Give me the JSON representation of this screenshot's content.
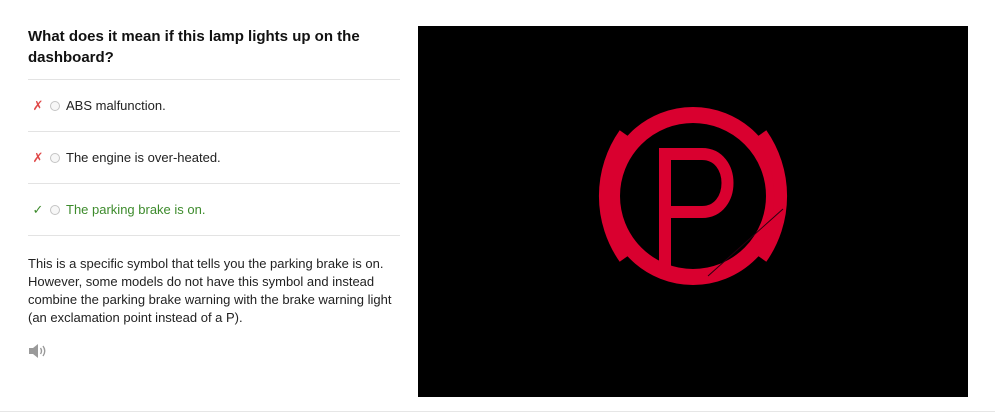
{
  "question": "What does it mean if this lamp lights up on the dashboard?",
  "answers": [
    {
      "mark": "✗",
      "label": "ABS malfunction.",
      "correct": false
    },
    {
      "mark": "✗",
      "label": "The engine is over-heated.",
      "correct": false
    },
    {
      "mark": "✓",
      "label": "The parking brake is on.",
      "correct": true
    }
  ],
  "explanation": "This is a specific symbol that tells you the parking brake is on. However, some models do not have this symbol and instead combine the parking brake warning with the brake warning light (an exclamation point instead of a P).",
  "icons": {
    "audio": "speaker-icon",
    "symbol": "parking-brake-warning-icon"
  },
  "symbol": {
    "letter": "P",
    "color": "#d9002f",
    "background": "#000000"
  },
  "colors": {
    "wrong": "#e04848",
    "correct": "#3d8b2c"
  }
}
